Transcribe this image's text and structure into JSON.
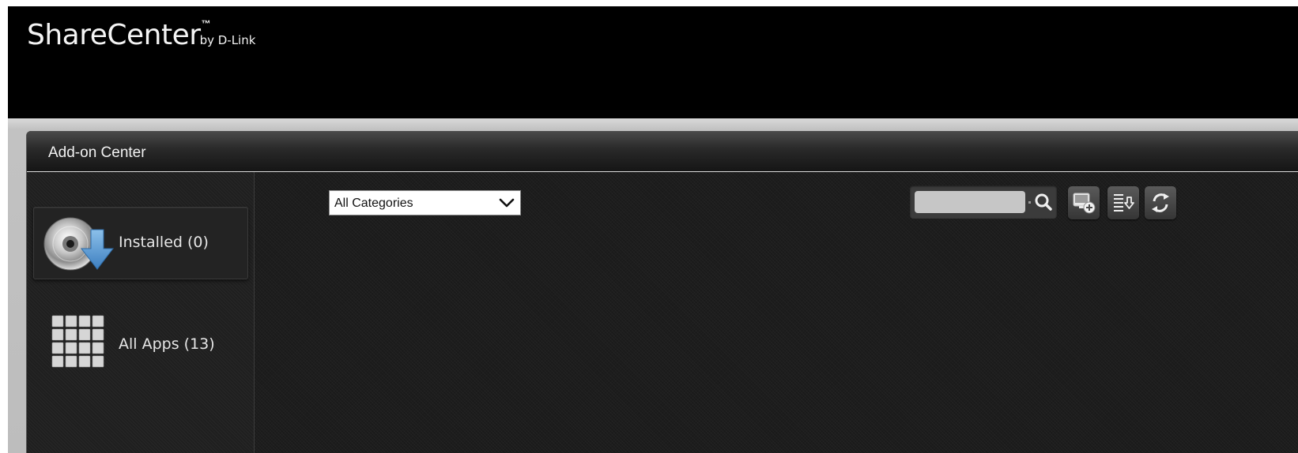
{
  "header": {
    "brand_name": "ShareCenter",
    "brand_tm": "™",
    "brand_by": "by D-Link"
  },
  "window": {
    "title": "Add-on Center"
  },
  "sidebar": {
    "items": [
      {
        "label": "Installed (0)",
        "icon": "installed-disc-icon"
      },
      {
        "label": "All Apps (13)",
        "icon": "apps-grid-icon"
      }
    ]
  },
  "toolbar": {
    "category_select": {
      "selected": "All Categories"
    },
    "search": {
      "value": "",
      "placeholder": "",
      "icon": "search-icon"
    },
    "buttons": [
      {
        "icon": "add-app-icon"
      },
      {
        "icon": "download-list-icon"
      },
      {
        "icon": "refresh-icon"
      }
    ]
  },
  "colors": {
    "header_bg": "#000000",
    "panel_bg": "#1c1c1c",
    "frame_bg": "#c2c2c2",
    "text": "#e6e6e6",
    "accent_arrow": "#5b9bd5"
  }
}
